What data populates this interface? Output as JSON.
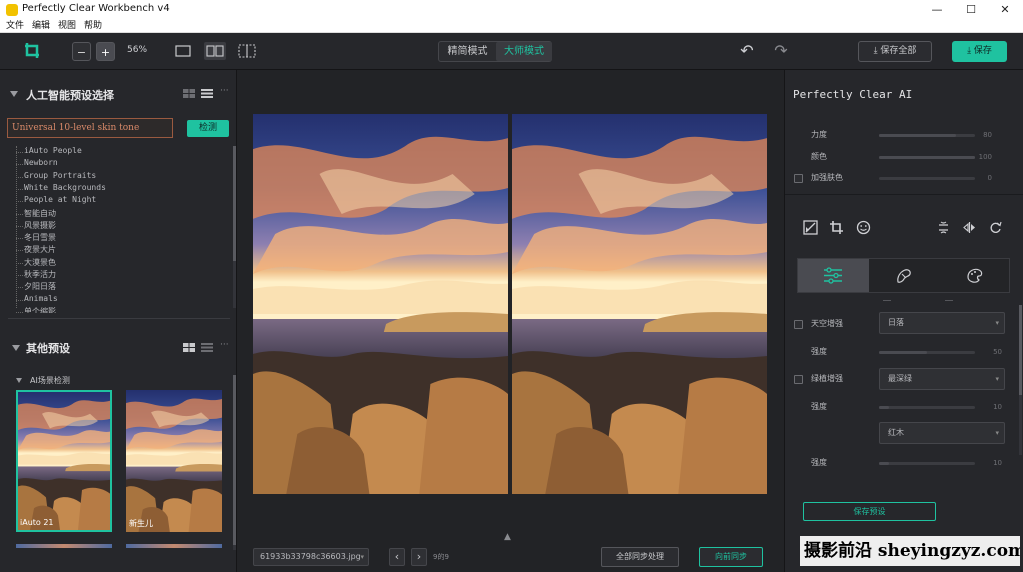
{
  "window": {
    "title": "Perfectly Clear Workbench v4",
    "controls": {
      "minimize": "—",
      "maximize": "☐",
      "close": "✕"
    }
  },
  "menu": [
    "文件",
    "编辑",
    "视图",
    "帮助"
  ],
  "toolbar": {
    "zoom_minus": "−",
    "zoom_plus": "+",
    "zoom_level": "56%",
    "modes": [
      "精简模式",
      "大师模式"
    ],
    "active_mode_index": 1,
    "undo": "↶",
    "redo": "↷",
    "save_all_label": "保存全部",
    "save_label": "保存",
    "accent_color": "#1fc2a0"
  },
  "left": {
    "ai_section_title": "人工智能预设选择",
    "search_value": "Universal 10-level skin tone",
    "detect_label": "检测",
    "presets": [
      "iAuto People",
      "Newborn",
      "Group Portraits",
      "White Backgrounds",
      "People at Night",
      "智能自动",
      "风景摄影",
      "冬日雪景",
      "夜景大片",
      "大漠景色",
      "秋季活力",
      "夕阳日落",
      "Animals",
      "单个缩影"
    ],
    "other_section_title": "其他预设",
    "ai_scene_title": "AI场景检测",
    "thumbnails": [
      {
        "label": "iAuto 21",
        "selected": true
      },
      {
        "label": "新生儿",
        "selected": false
      }
    ]
  },
  "center": {
    "filename": "61933b33798c36603.jpg",
    "prev": "‹",
    "next": "›",
    "counter": "9的9",
    "sync_all_label": "全部同步处理",
    "sync_back_label": "向前同步",
    "expand_icon": "▲"
  },
  "right": {
    "panel_title": "Perfectly Clear AI",
    "sliders_top": [
      {
        "label": "力度",
        "value": "80",
        "fraction": 0.8,
        "checkbox": false
      },
      {
        "label": "颜色",
        "value": "100",
        "fraction": 1.0,
        "checkbox": false
      },
      {
        "label": "加强肤色",
        "value": "0",
        "fraction": 0,
        "checkbox": true
      }
    ],
    "sky": {
      "label": "天空增强",
      "select": "日落",
      "strength_label": "强度",
      "strength_value": "50",
      "strength_fraction": 0.5
    },
    "foliage": {
      "label": "绿植增强",
      "select": "最深绿",
      "strength_label": "强度",
      "strength_value": "10",
      "strength_fraction": 0.1,
      "select2": "红木",
      "strength2_label": "强度",
      "strength2_value": "10",
      "strength2_fraction": 0.1
    },
    "save_preset_label": "保存预设"
  },
  "watermark": "摄影前沿 sheyingzyz.com"
}
